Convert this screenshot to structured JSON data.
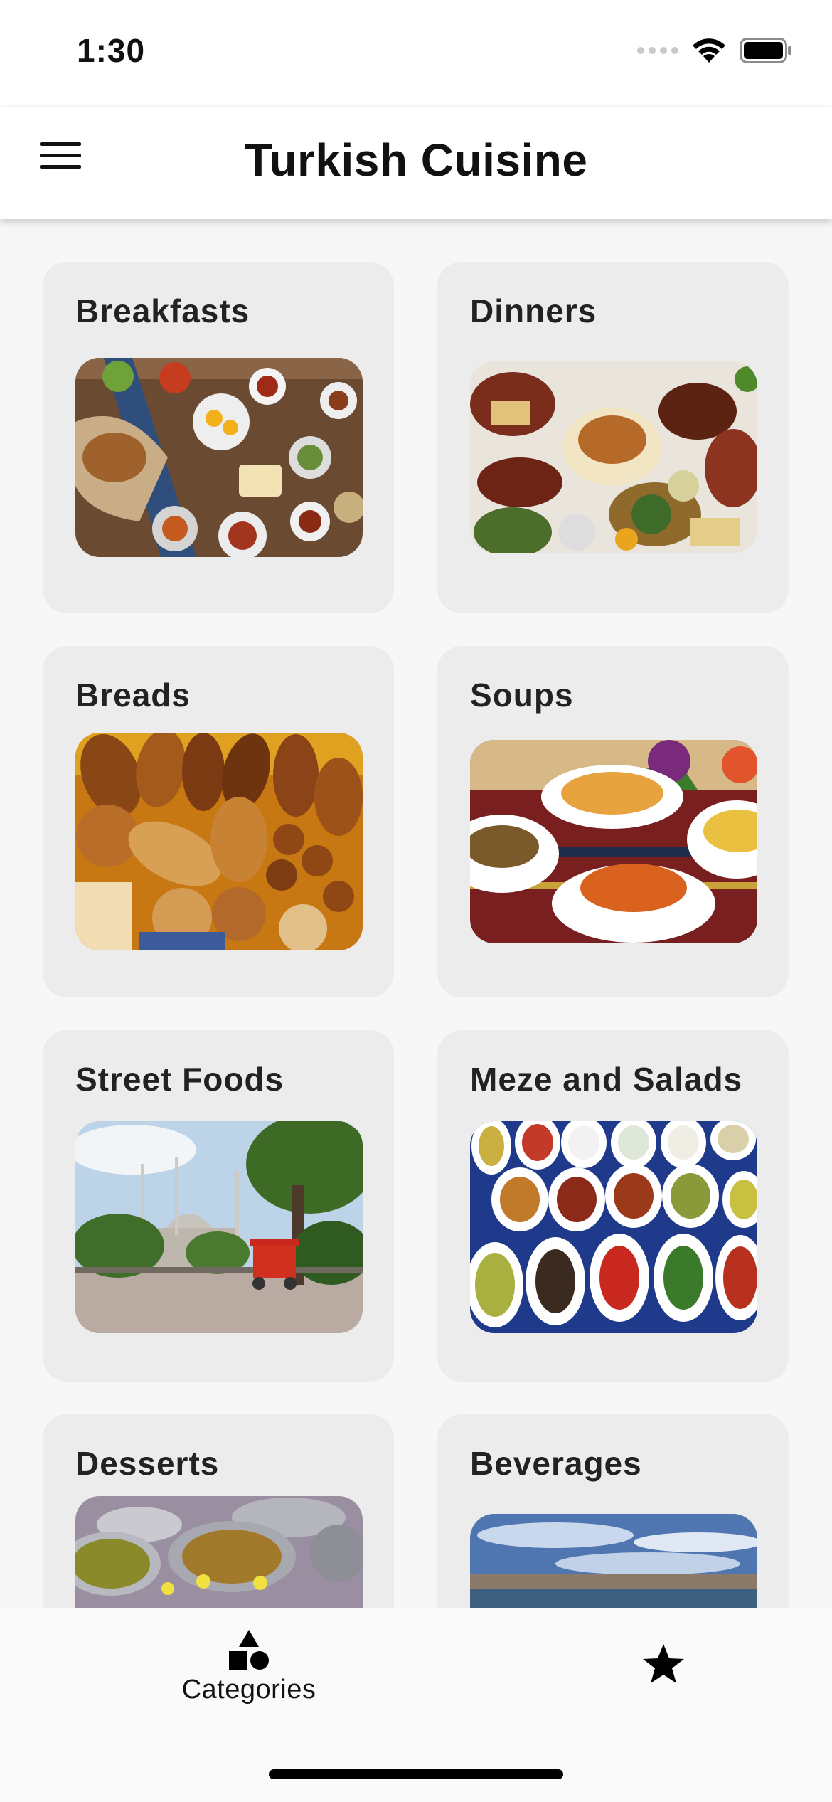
{
  "status_bar": {
    "time": "1:30",
    "icons": [
      "cellular-signal-icon",
      "wifi-icon",
      "battery-icon"
    ]
  },
  "app_bar": {
    "title": "Turkish Cuisine",
    "menu_icon": "hamburger-menu-icon"
  },
  "categories": [
    {
      "title": "Breakfasts",
      "image": "breakfast-spread-photo"
    },
    {
      "title": "Dinners",
      "image": "dinner-table-photo"
    },
    {
      "title": "Breads",
      "image": "bread-assortment-photo"
    },
    {
      "title": "Soups",
      "image": "soup-bowls-photo"
    },
    {
      "title": "Street Foods",
      "image": "mosque-square-simit-cart-photo"
    },
    {
      "title": "Meze and Salads",
      "image": "meze-plates-photo"
    },
    {
      "title": "Desserts",
      "image": "dessert-trays-photo"
    },
    {
      "title": "Beverages",
      "image": "bosphorus-sky-photo"
    }
  ],
  "bottom_nav": {
    "tabs": [
      {
        "label": "Categories",
        "icon": "categories-shapes-icon",
        "selected": true
      },
      {
        "label": "",
        "icon": "star-icon",
        "selected": false
      }
    ]
  },
  "colors": {
    "background": "#f7f7f7",
    "card": "#ececec",
    "app_bar": "#ffffff",
    "text": "#111111"
  }
}
